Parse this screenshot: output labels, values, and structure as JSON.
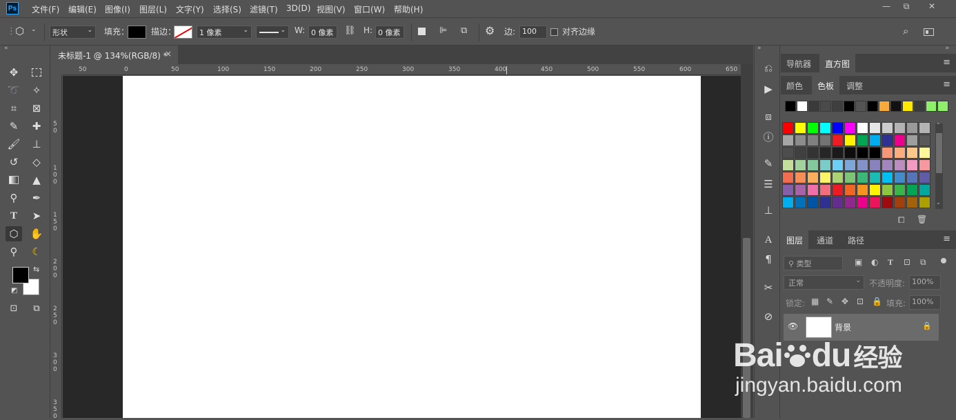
{
  "app": {
    "logo": "Ps"
  },
  "menu": [
    "文件(F)",
    "编辑(E)",
    "图像(I)",
    "图层(L)",
    "文字(Y)",
    "选择(S)",
    "滤镜(T)",
    "3D(D)",
    "视图(V)",
    "窗口(W)",
    "帮助(H)"
  ],
  "window_controls": {
    "minimize": "—",
    "restore": "⧉",
    "close": "✕"
  },
  "options": {
    "mode_value": "形状",
    "fill_label": "填充：",
    "stroke_label": "描边：",
    "stroke_width_value": "1 像素",
    "w_label": "W:",
    "w_value": "0 像素",
    "h_label": "H:",
    "h_value": "0 像素",
    "sides_label": "边:",
    "sides_value": "100",
    "align_edges_label": "对齐边缘"
  },
  "document": {
    "tab_title": "未标题-1 @ 134%(RGB/8) *",
    "close_glyph": "×",
    "ruler_top_ticks": [
      "50",
      "0",
      "50",
      "100",
      "150",
      "200",
      "250",
      "300",
      "350",
      "400",
      "450",
      "500",
      "550",
      "600",
      "650"
    ],
    "ruler_left_ticks": [
      "5\n0",
      "1\n0\n0",
      "1\n5\n0",
      "2\n0\n0",
      "2\n5\n0",
      "3\n0\n0",
      "3\n5\n0"
    ]
  },
  "panels": {
    "top_tabs": [
      "导航器",
      "直方图"
    ],
    "top_active": "直方图",
    "swatch_tabs": [
      "颜色",
      "色板",
      "调整"
    ],
    "swatch_active": "色板",
    "recent_swatches": [
      "#000000",
      "#ffffff",
      "#3a3a3a",
      "#4a4a4a",
      "#3f3f3f",
      "#000000",
      "#545454",
      "#000000",
      "#f7a93a",
      "#111111",
      "#ffea00",
      "#3a3a3a",
      "#8ef06a",
      "#8ef06a"
    ],
    "swatches": [
      [
        "#ff0000",
        "#ffff00",
        "#00ff00",
        "#00ffff",
        "#0000ff",
        "#ff00ff",
        "#ffffff",
        "#e6e6e6",
        "#cccccc",
        "#b3b3b3",
        "#999999",
        "#b3b3b3"
      ],
      [
        "#a6a6a6",
        "#8c8c8c",
        "#808080",
        "#737373",
        "#ee1d24",
        "#fff200",
        "#00a651",
        "#00aeef",
        "#2e3192",
        "#ec008c",
        "#9e9e9e",
        "#595959"
      ],
      [
        "#4d4d4d",
        "#404040",
        "#333333",
        "#262626",
        "#1a1a1a",
        "#0d0d0d",
        "#000000",
        "#000000",
        "#f7977a",
        "#f9ad81",
        "#fdc68a",
        "#fff79a"
      ],
      [
        "#c4df9b",
        "#a3d39c",
        "#82ca9c",
        "#7accc8",
        "#6dcff6",
        "#7da7d9",
        "#8393ca",
        "#8882be",
        "#a187be",
        "#bc8dbf",
        "#f49ac2",
        "#f6989d"
      ],
      [
        "#f26c4f",
        "#f68e55",
        "#fbaf5c",
        "#fff467",
        "#acd372",
        "#7cc576",
        "#3bb878",
        "#1abbb4",
        "#00bff3",
        "#438ccb",
        "#5574b9",
        "#605ca8"
      ],
      [
        "#8560a8",
        "#a863a8",
        "#f06eaa",
        "#f26d7d",
        "#ed1c24",
        "#f26522",
        "#f7941d",
        "#fff200",
        "#8dc73f",
        "#39b54a",
        "#00a651",
        "#00a99d"
      ],
      [
        "#00aeef",
        "#0072bc",
        "#0054a6",
        "#2e3192",
        "#662d91",
        "#92278f",
        "#ec008c",
        "#ed145b",
        "#9e0b0f",
        "#a0410d",
        "#a3620a",
        "#aba000"
      ]
    ],
    "layer_tabs": [
      "图层",
      "通道",
      "路径"
    ],
    "layer_active": "图层",
    "filter_placeholder": "类型",
    "blend_mode": "正常",
    "opacity_label": "不透明度:",
    "opacity_value": "100%",
    "lock_label": "锁定:",
    "fill_label": "填充:",
    "fill_value": "100%",
    "layer_name": "背景"
  },
  "watermark": {
    "brand": "Bai",
    "brand2": "du",
    "suffix": "经验",
    "url": "jingyan.baidu.com"
  }
}
